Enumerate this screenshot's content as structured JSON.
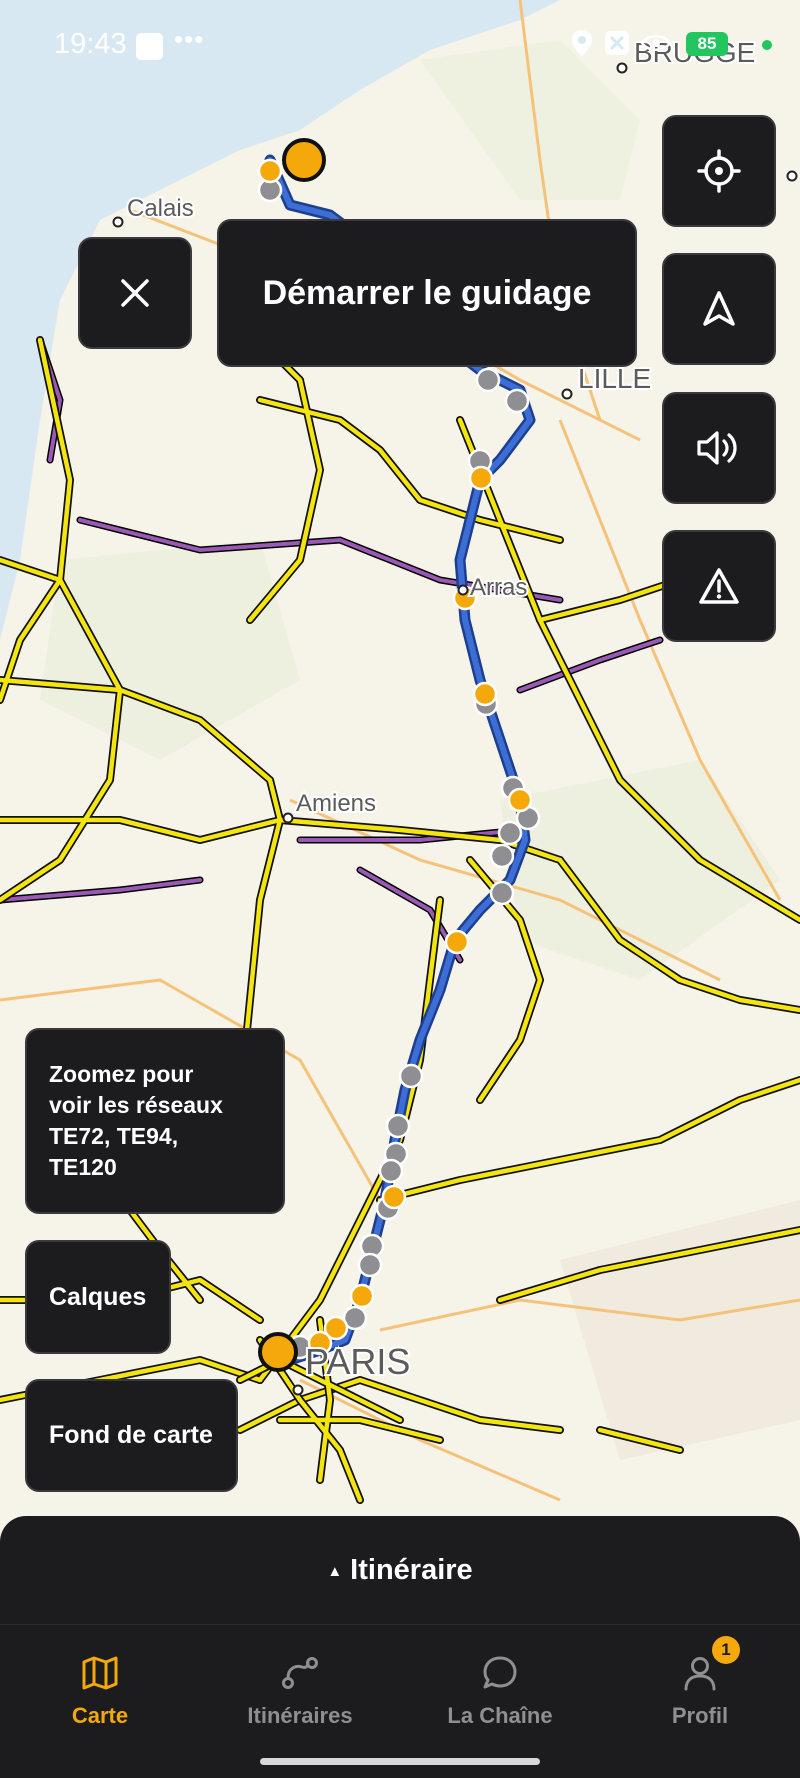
{
  "status_bar": {
    "time": "19:43",
    "dots": "•••",
    "battery": "85",
    "icons": [
      "location-pin-icon",
      "x-box-icon",
      "eye-icon"
    ]
  },
  "map": {
    "places": {
      "calais": "Calais",
      "lille": "LILLE",
      "arras": "Arras",
      "amiens": "Amiens",
      "paris": "PARIS",
      "brugge": "BRUGGE"
    },
    "colors": {
      "sea": "#d8e8f2",
      "land": "#f6f3e9",
      "route": "#3d6ed6",
      "route_outline": "#1d3f8f",
      "network_primary": "#f5e50f",
      "network_secondary": "#9b59b6",
      "poi_orange": "#f5a80a",
      "poi_grey": "#8e8e93"
    }
  },
  "controls": {
    "close_icon": "close-icon",
    "start_guidance": "Démarrer le guidage",
    "locate_icon": "crosshair-icon",
    "navigate_icon": "navigation-arrow-icon",
    "sound_icon": "speaker-icon",
    "warning_icon": "warning-triangle-icon",
    "zoom_hint": "Zoomez pour\nvoir les réseaux\nTE72, TE94,\nTE120",
    "layers": "Calques",
    "basemap": "Fond de carte"
  },
  "itinerary": {
    "caret": "▲",
    "label": "Itinéraire"
  },
  "nav": {
    "items": [
      {
        "label": "Carte",
        "icon": "map-icon",
        "active": true
      },
      {
        "label": "Itinéraires",
        "icon": "route-icon",
        "active": false
      },
      {
        "label": "La Chaîne",
        "icon": "chat-bubble-icon",
        "active": false
      },
      {
        "label": "Profil",
        "icon": "person-icon",
        "active": false
      }
    ],
    "profile_badge": "1"
  }
}
